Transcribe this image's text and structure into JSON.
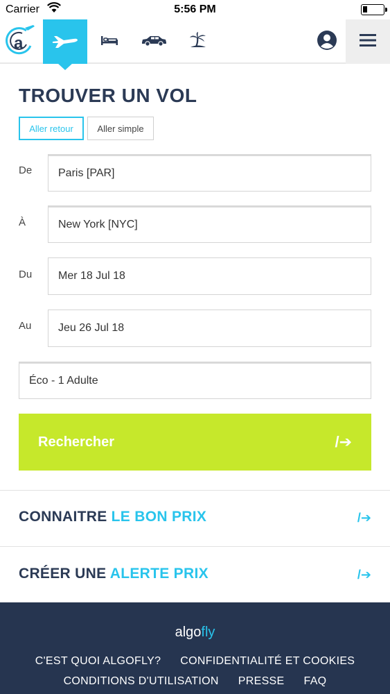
{
  "status_bar": {
    "carrier": "Carrier",
    "time": "5:56 PM"
  },
  "nav": {
    "items": [
      {
        "icon": "plane-icon",
        "active": true
      },
      {
        "icon": "bed-icon",
        "active": false
      },
      {
        "icon": "car-icon",
        "active": false
      },
      {
        "icon": "palm-tree-icon",
        "active": false
      }
    ],
    "accent_color": "#29c4ec"
  },
  "search": {
    "title": "TROUVER UN VOL",
    "trip_types": {
      "round_trip": "Aller retour",
      "one_way": "Aller simple"
    },
    "fields": {
      "from": {
        "label": "De",
        "value": "Paris [PAR]"
      },
      "to": {
        "label": "À",
        "value": "New York [NYC]"
      },
      "depart": {
        "label": "Du",
        "value": "Mer 18 Jul 18"
      },
      "return": {
        "label": "Au",
        "value": "Jeu 26 Jul 18"
      },
      "passengers": {
        "value": "Éco - 1 Adulte"
      }
    },
    "button_label": "Rechercher",
    "button_color": "#c6e82b"
  },
  "links": {
    "price": {
      "text_a": "CONNAITRE ",
      "text_b": "LE BON PRIX"
    },
    "alert": {
      "text_a": "CRÉER UNE ",
      "text_b": "ALERTE PRIX"
    }
  },
  "footer": {
    "brand_a": "algo",
    "brand_b": "fly",
    "links": [
      "C'EST QUOI ALGOFLY?",
      "CONFIDENTIALITÉ ET COOKIES",
      "CONDITIONS D'UTILISATION",
      "PRESSE",
      "FAQ"
    ],
    "background": "#263550"
  }
}
